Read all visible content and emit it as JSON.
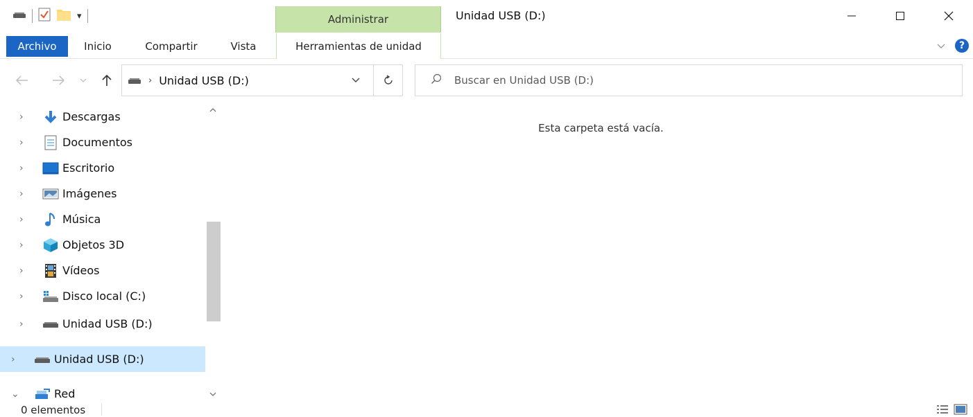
{
  "window": {
    "title": "Unidad USB (D:)",
    "context_tab_group": "Administrar",
    "minimize_glyph": "—",
    "maximize_glyph": "☐",
    "close_glyph": "✕"
  },
  "quick_access": {
    "icons": [
      "drive-icon",
      "properties-icon",
      "new-folder-icon",
      "customize-toolbar-icon"
    ]
  },
  "ribbon": {
    "tabs": [
      {
        "label": "Archivo",
        "active": true
      },
      {
        "label": "Inicio"
      },
      {
        "label": "Compartir"
      },
      {
        "label": "Vista"
      },
      {
        "label": "Herramientas de unidad"
      }
    ],
    "help_glyph": "?"
  },
  "address": {
    "path": [
      {
        "label": "Unidad USB (D:)"
      }
    ],
    "search_placeholder": "Buscar en Unidad USB (D:)"
  },
  "nav_pane": {
    "items": [
      {
        "label": "Descargas",
        "icon": "downloads-icon"
      },
      {
        "label": "Documentos",
        "icon": "documents-icon"
      },
      {
        "label": "Escritorio",
        "icon": "desktop-icon"
      },
      {
        "label": "Imágenes",
        "icon": "pictures-icon"
      },
      {
        "label": "Música",
        "icon": "music-icon"
      },
      {
        "label": "Objetos 3D",
        "icon": "3d-objects-icon"
      },
      {
        "label": "Vídeos",
        "icon": "videos-icon"
      },
      {
        "label": "Disco local (C:)",
        "icon": "local-disk-icon"
      },
      {
        "label": "Unidad USB (D:)",
        "icon": "usb-drive-icon"
      },
      {
        "label": "Unidad USB (D:)",
        "icon": "usb-drive-icon",
        "selected": true
      },
      {
        "label": "Red",
        "icon": "network-icon",
        "expanded": true
      }
    ]
  },
  "content": {
    "empty_message": "Esta carpeta está vacía."
  },
  "status_bar": {
    "item_count": "0 elementos"
  },
  "colors": {
    "accent": "#1b65c4",
    "context_tab": "#c6e3a9",
    "selection": "#cce8ff"
  }
}
